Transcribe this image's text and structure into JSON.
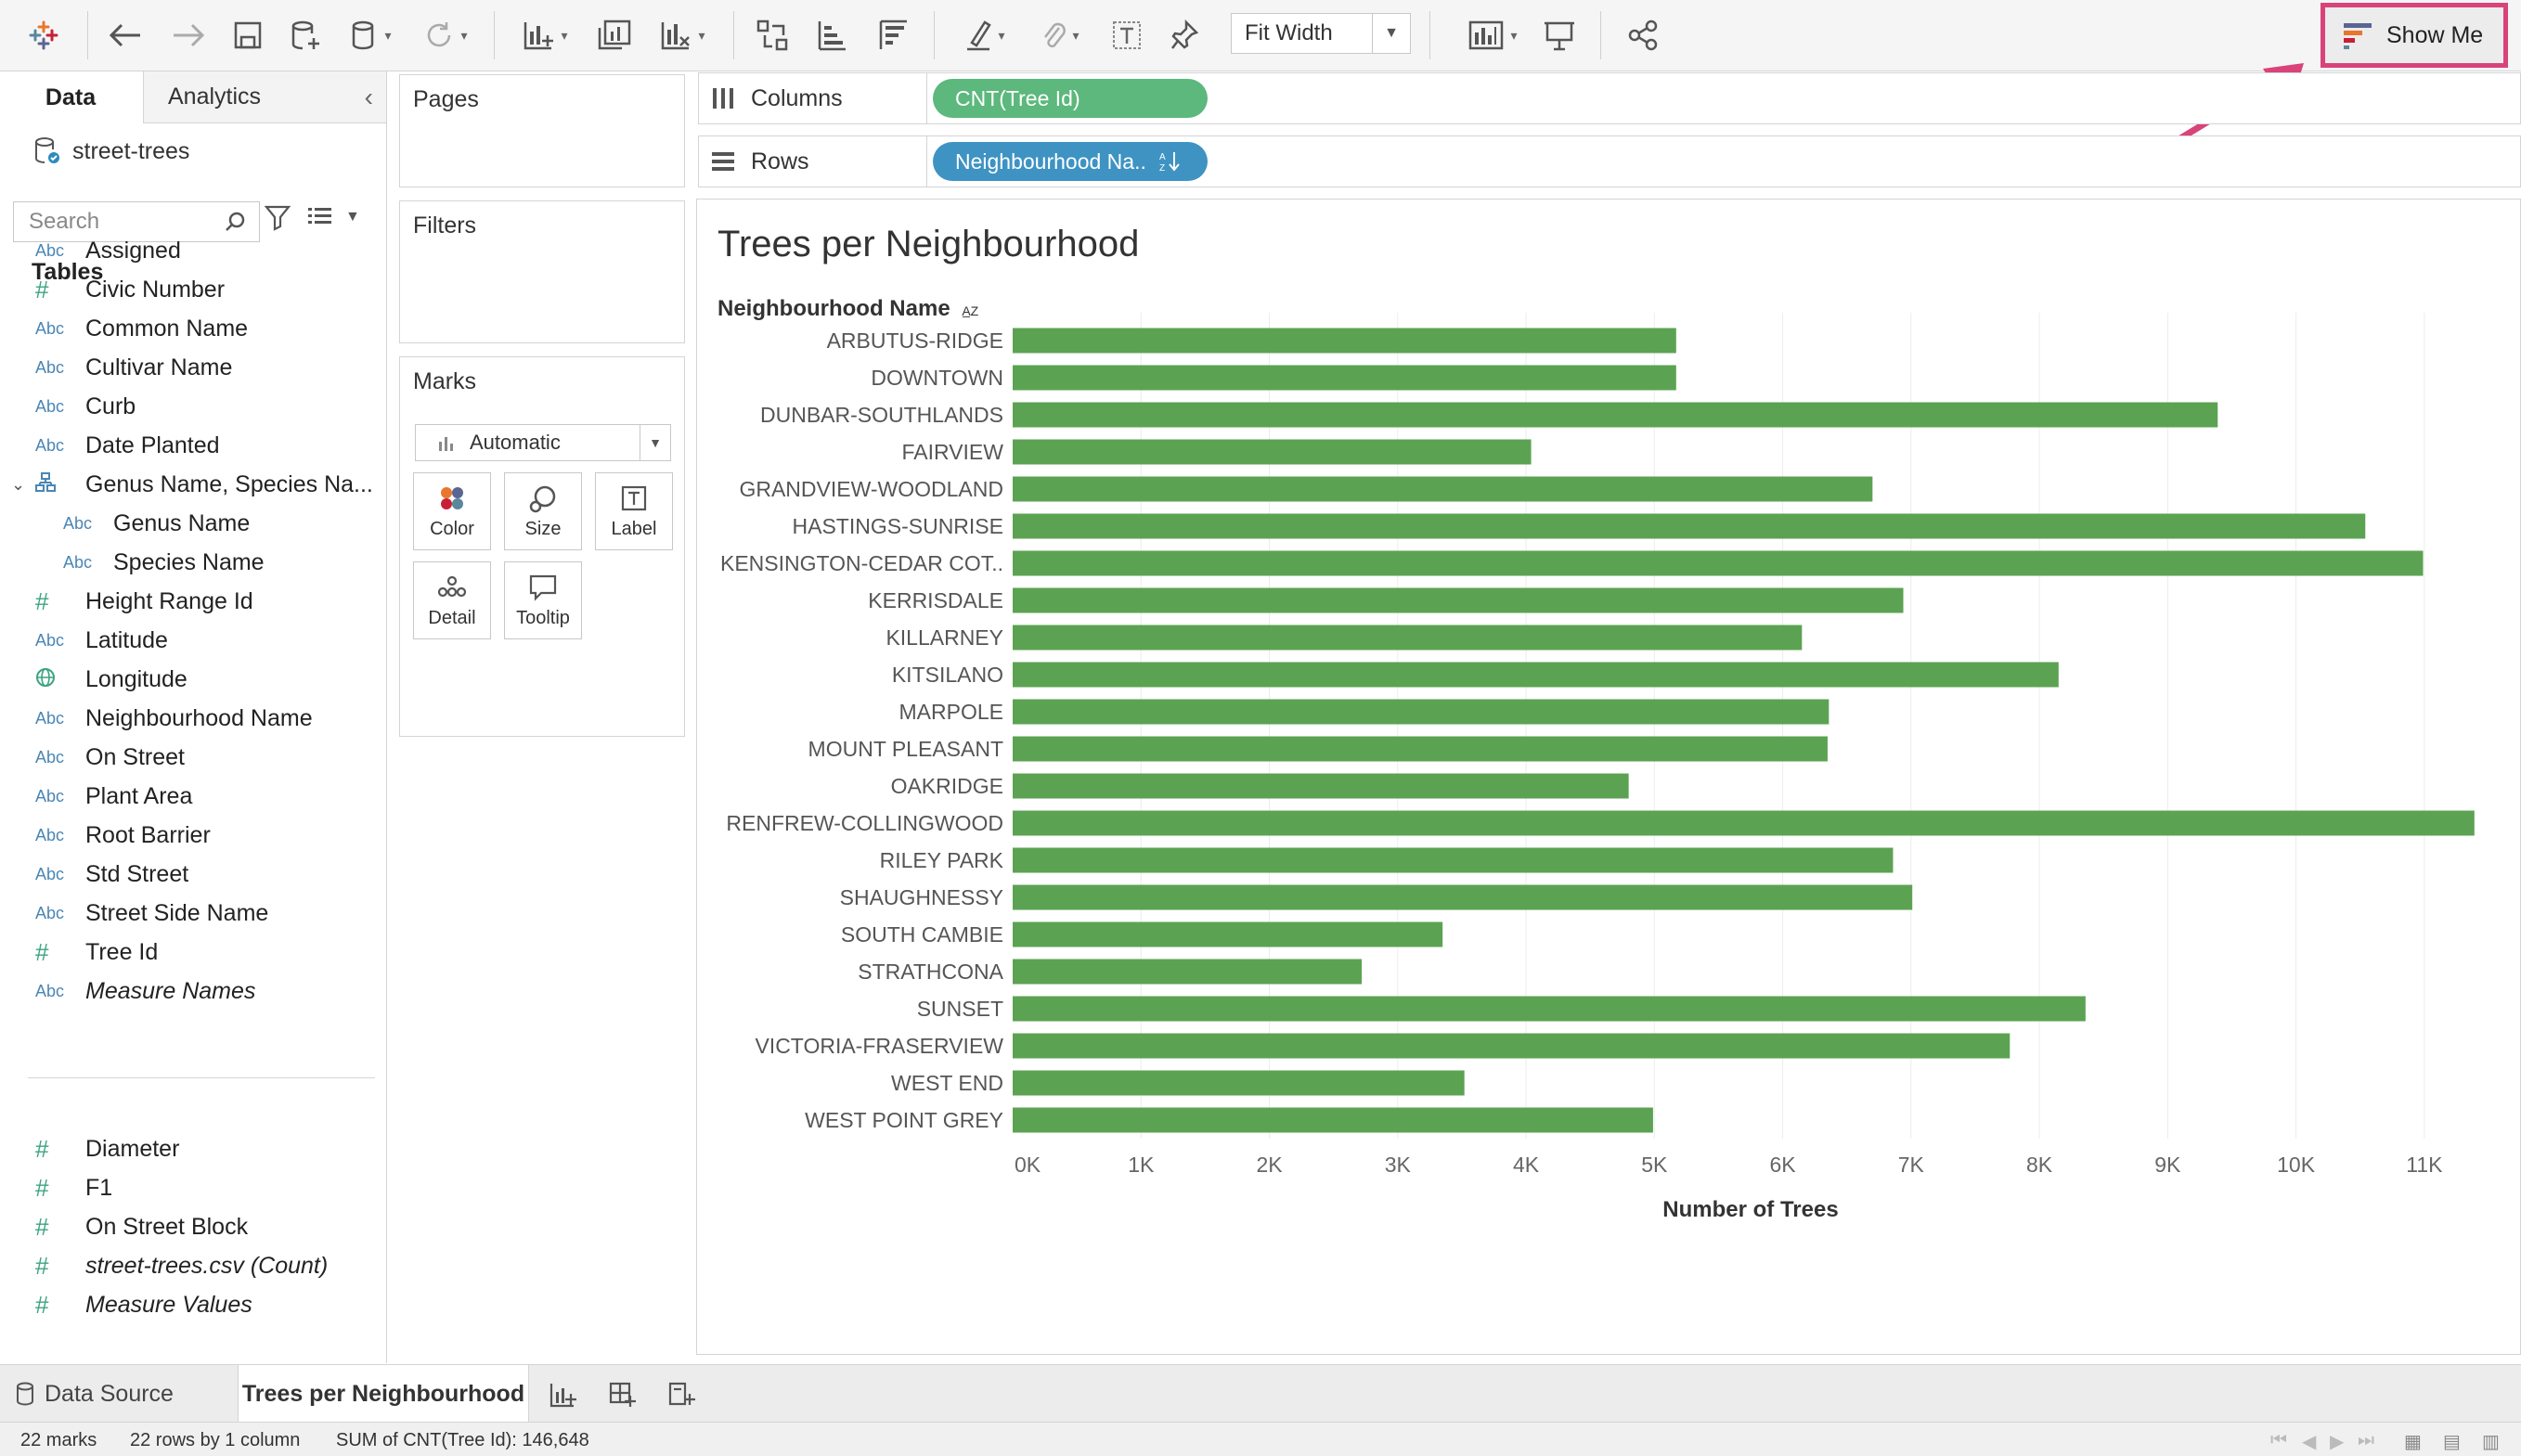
{
  "toolbar": {
    "fit_width": "Fit Width",
    "show_me": "Show Me"
  },
  "data_pane": {
    "tab_data": "Data",
    "tab_analytics": "Analytics",
    "datasource": "street-trees",
    "search_placeholder": "Search",
    "tables_title": "Tables",
    "fields": [
      {
        "type": "abc",
        "name": "Assigned"
      },
      {
        "type": "num",
        "name": "Civic Number"
      },
      {
        "type": "abc",
        "name": "Common Name"
      },
      {
        "type": "abc",
        "name": "Cultivar Name"
      },
      {
        "type": "abc",
        "name": "Curb"
      },
      {
        "type": "abc",
        "name": "Date Planted"
      },
      {
        "type": "hier",
        "name": "Genus Name, Species Na..."
      },
      {
        "type": "abc",
        "name": "Genus Name",
        "child": true
      },
      {
        "type": "abc",
        "name": "Species Name",
        "child": true
      },
      {
        "type": "num",
        "name": "Height Range Id"
      },
      {
        "type": "abc",
        "name": "Latitude"
      },
      {
        "type": "geo",
        "name": "Longitude"
      },
      {
        "type": "abc",
        "name": "Neighbourhood Name"
      },
      {
        "type": "abc",
        "name": "On Street"
      },
      {
        "type": "abc",
        "name": "Plant Area"
      },
      {
        "type": "abc",
        "name": "Root Barrier"
      },
      {
        "type": "abc",
        "name": "Std Street"
      },
      {
        "type": "abc",
        "name": "Street Side Name"
      },
      {
        "type": "num",
        "name": "Tree Id"
      },
      {
        "type": "abc",
        "name": "Measure Names",
        "italic": true
      }
    ],
    "measures": [
      {
        "type": "num",
        "name": "Diameter"
      },
      {
        "type": "num",
        "name": "F1"
      },
      {
        "type": "num",
        "name": "On Street Block"
      },
      {
        "type": "num",
        "name": "street-trees.csv (Count)",
        "italic": true
      },
      {
        "type": "num",
        "name": "Measure Values",
        "italic": true
      }
    ]
  },
  "cards": {
    "pages": "Pages",
    "filters": "Filters",
    "marks": "Marks",
    "marks_type": "Automatic",
    "mark_buttons": [
      "Color",
      "Size",
      "Label",
      "Detail",
      "Tooltip"
    ]
  },
  "shelves": {
    "columns_label": "Columns",
    "columns_pill": "CNT(Tree Id)",
    "rows_label": "Rows",
    "rows_pill": "Neighbourhood Na.."
  },
  "viz": {
    "title": "Trees per Neighbourhood",
    "row_header": "Neighbourhood Name",
    "bar_color": "#5ba352"
  },
  "chart_data": {
    "type": "bar",
    "orientation": "horizontal",
    "title": "Trees per Neighbourhood",
    "ylabel": "Neighbourhood Name",
    "xlabel": "Number of Trees",
    "xlim": [
      0,
      11500
    ],
    "x_ticks": [
      0,
      1000,
      2000,
      3000,
      4000,
      5000,
      6000,
      7000,
      8000,
      9000,
      10000,
      11000
    ],
    "x_tick_labels": [
      "0K",
      "1K",
      "2K",
      "3K",
      "4K",
      "5K",
      "6K",
      "7K",
      "8K",
      "9K",
      "10K",
      "11K"
    ],
    "grid": true,
    "categories": [
      "ARBUTUS-RIDGE",
      "DOWNTOWN",
      "DUNBAR-SOUTHLANDS",
      "FAIRVIEW",
      "GRANDVIEW-WOODLAND",
      "HASTINGS-SUNRISE",
      "KENSINGTON-CEDAR COT..",
      "KERRISDALE",
      "KILLARNEY",
      "KITSILANO",
      "MARPOLE",
      "MOUNT PLEASANT",
      "OAKRIDGE",
      "RENFREW-COLLINGWOOD",
      "RILEY PARK",
      "SHAUGHNESSY",
      "SOUTH CAMBIE",
      "STRATHCONA",
      "SUNSET",
      "VICTORIA-FRASERVIEW",
      "WEST END",
      "WEST POINT GREY"
    ],
    "values": [
      5170,
      5170,
      9390,
      4040,
      6700,
      10540,
      10990,
      6940,
      6150,
      8150,
      6360,
      6350,
      4800,
      11390,
      6860,
      7010,
      3350,
      2720,
      8360,
      7770,
      3520,
      4990
    ]
  },
  "sheets": {
    "data_source": "Data Source",
    "active": "Trees per Neighbourhood"
  },
  "status": {
    "marks": "22 marks",
    "rows": "22 rows by 1 column",
    "sum": "SUM of CNT(Tree Id): 146,648"
  }
}
